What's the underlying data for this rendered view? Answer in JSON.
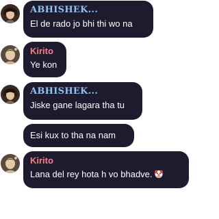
{
  "chat": {
    "messages": [
      {
        "author": "ABHISHEK...",
        "author_color": "#8fc3f2",
        "text": "El de rado jo bhi thi wo na"
      },
      {
        "author": "Kirito",
        "author_color": "#f0828e",
        "text": "Ye kon"
      },
      {
        "author": "ABHISHEK...",
        "author_color": "#8fc3f2",
        "text": "Jiske gane lagara tha tu"
      },
      {
        "author": "",
        "text": "Esi kux to tha na nam"
      },
      {
        "author": "Kirito",
        "author_color": "#f0828e",
        "text": "Lana del rey hota h vo bhadve.",
        "emoji": "clown-face-icon"
      }
    ]
  },
  "colors": {
    "bubble_bg": "#1f1b2e",
    "text": "#ffffff",
    "page_bg": "#ffffff"
  }
}
